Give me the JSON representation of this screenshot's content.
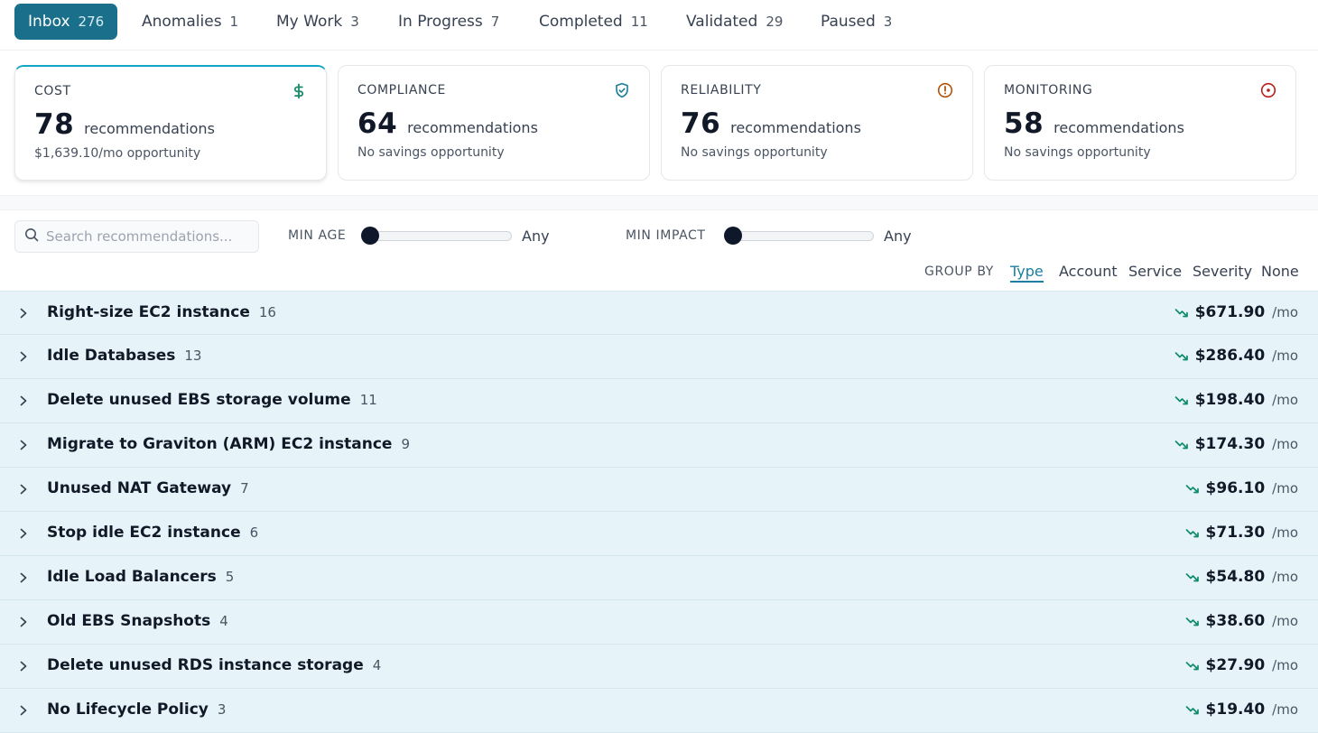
{
  "tabs": [
    {
      "label": "Inbox",
      "count": "276",
      "active": true
    },
    {
      "label": "Anomalies",
      "count": "1"
    },
    {
      "label": "My Work",
      "count": "3"
    },
    {
      "label": "In Progress",
      "count": "7"
    },
    {
      "label": "Completed",
      "count": "11"
    },
    {
      "label": "Validated",
      "count": "29"
    },
    {
      "label": "Paused",
      "count": "3"
    }
  ],
  "cards": [
    {
      "title": "COST",
      "count": "78",
      "unit": "recommendations",
      "sub": "$1,639.10/mo opportunity",
      "icon": "dollar-icon",
      "color": "#1a8a6a"
    },
    {
      "title": "COMPLIANCE",
      "count": "64",
      "unit": "recommendations",
      "sub": "No savings opportunity",
      "icon": "shield-check-icon",
      "color": "#1a7f9a"
    },
    {
      "title": "RELIABILITY",
      "count": "76",
      "unit": "recommendations",
      "sub": "No savings opportunity",
      "icon": "alert-circle-icon",
      "color": "#b45309"
    },
    {
      "title": "MONITORING",
      "count": "58",
      "unit": "recommendations",
      "sub": "No savings opportunity",
      "icon": "target-icon",
      "color": "#b91c1c"
    }
  ],
  "filters": {
    "search_placeholder": "Search recommendations...",
    "min_age_label": "MIN AGE",
    "min_age_value": "Any",
    "min_impact_label": "MIN IMPACT",
    "min_impact_value": "Any"
  },
  "group_by": {
    "label": "GROUP BY",
    "options": [
      "Type",
      "Account",
      "Service",
      "Severity",
      "None"
    ],
    "selected": "Type"
  },
  "groups": [
    {
      "name": "Right-size EC2 instance",
      "count": "16",
      "amount": "$671.90",
      "unit": "/mo"
    },
    {
      "name": "Idle Databases",
      "count": "13",
      "amount": "$286.40",
      "unit": "/mo"
    },
    {
      "name": "Delete unused EBS storage volume",
      "count": "11",
      "amount": "$198.40",
      "unit": "/mo"
    },
    {
      "name": "Migrate to Graviton (ARM) EC2 instance",
      "count": "9",
      "amount": "$174.30",
      "unit": "/mo"
    },
    {
      "name": "Unused NAT Gateway",
      "count": "7",
      "amount": "$96.10",
      "unit": "/mo"
    },
    {
      "name": "Stop idle EC2 instance",
      "count": "6",
      "amount": "$71.30",
      "unit": "/mo"
    },
    {
      "name": "Idle Load Balancers",
      "count": "5",
      "amount": "$54.80",
      "unit": "/mo"
    },
    {
      "name": "Old EBS Snapshots",
      "count": "4",
      "amount": "$38.60",
      "unit": "/mo"
    },
    {
      "name": "Delete unused RDS instance storage",
      "count": "4",
      "amount": "$27.90",
      "unit": "/mo"
    },
    {
      "name": "No Lifecycle Policy",
      "count": "3",
      "amount": "$19.40",
      "unit": "/mo"
    }
  ],
  "colors": {
    "accent": "#1a6f8a",
    "trend": "#0f8a6a",
    "group_bg": "#e6f4f9"
  }
}
